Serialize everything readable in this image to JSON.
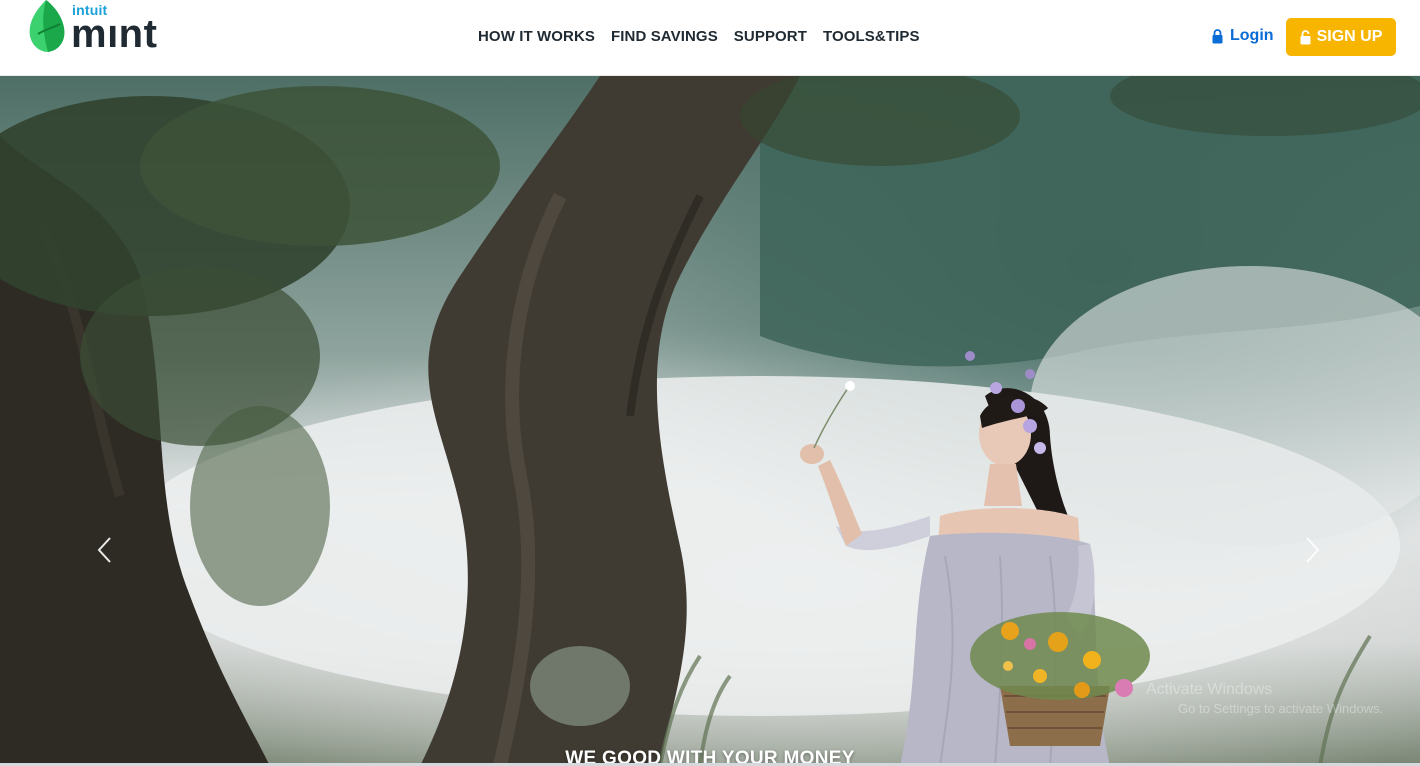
{
  "header": {
    "logo": {
      "small_text": "intuit",
      "main_text": "mınt",
      "icon": "mint-leaf-icon"
    },
    "nav_links": [
      {
        "label": "HOW IT WORKS"
      },
      {
        "label": "FIND SAVINGS"
      },
      {
        "label": "SUPPORT"
      },
      {
        "label": "TOOLS&TIPS"
      }
    ],
    "login": {
      "label": "Login",
      "icon": "lock-icon"
    },
    "signup": {
      "label": "SIGN UP",
      "icon": "lock-icon"
    }
  },
  "hero": {
    "caption": "WE GOOD WITH YOUR MONEY",
    "prev_icon": "chevron-left-icon",
    "next_icon": "chevron-right-icon",
    "watermark_title": "Activate Windows",
    "watermark_sub": "Go to Settings to activate Windows."
  },
  "colors": {
    "brand_blue": "#1ba0d8",
    "brand_dark": "#1f2a33",
    "login_blue": "#0a6cd4",
    "signup_yellow": "#f7b500",
    "leaf_green": "#3bd16f"
  }
}
